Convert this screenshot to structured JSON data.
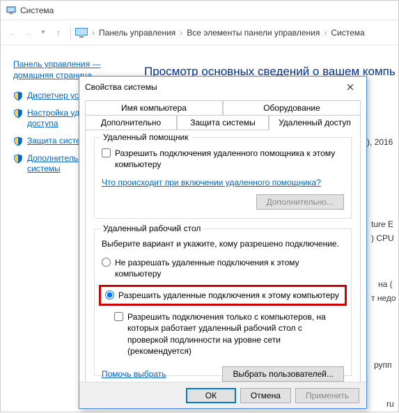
{
  "cp": {
    "title": "Система",
    "crumb1": "Панель управления",
    "crumb2": "Все элементы панели управления",
    "crumb3": "Система",
    "side_home": "Панель управления — домашняя страница",
    "side_links": [
      "Диспетчер устр",
      "Настройка удал\nдоступа",
      "Защита систем",
      "Дополнительны\nсистемы"
    ],
    "heading": "Просмотр основных сведений о вашем компь",
    "frag_year": "), 2016",
    "frag_ture": "ture E",
    "frag_cpu": ") CPU",
    "frag_na": "на (",
    "frag_nedo": "т недо",
    "frag_rupp": "рупп",
    "frag_ru": "ru"
  },
  "dlg": {
    "title": "Свойства системы",
    "tabs": {
      "t1": "Имя компьютера",
      "t2": "Оборудование",
      "t3": "Дополнительно",
      "t4": "Защита системы",
      "t5": "Удаленный доступ"
    },
    "group1": {
      "title": "Удаленный помощник",
      "chk": "Разрешить подключения удаленного помощника к этому компьютеру",
      "link": "Что происходит при включении удаленного помощника?",
      "btn": "Дополнительно..."
    },
    "group2": {
      "title": "Удаленный рабочий стол",
      "desc": "Выберите вариант и укажите, кому разрешено подключение.",
      "r1": "Не разрешать удаленные подключения к этому компьютеру",
      "r2": "Разрешить удаленные подключения к этому компьютеру",
      "chk": "Разрешить подключения только с компьютеров, на которых работает удаленный рабочий стол с проверкой подлинности на уровне сети (рекомендуется)",
      "help": "Помочь выбрать",
      "btn": "Выбрать пользователей..."
    },
    "ok": "ОК",
    "cancel": "Отмена",
    "apply": "Применить"
  }
}
